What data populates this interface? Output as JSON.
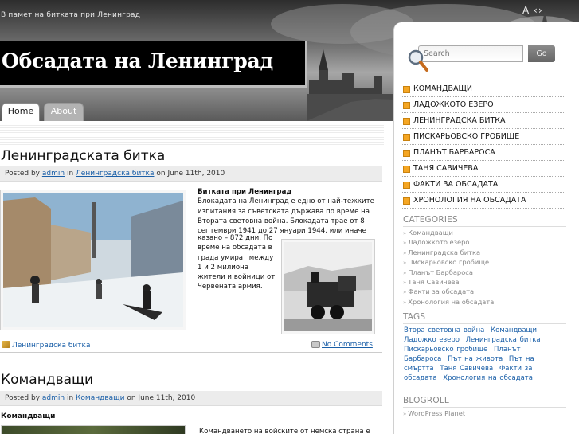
{
  "header": {
    "tagline": "В памет на битката при Ленинград",
    "site_title": "Обсадата на Ленинград",
    "font_tools": "A ‹›"
  },
  "nav": {
    "tabs": [
      {
        "label": "Home",
        "active": true
      },
      {
        "label": "About",
        "active": false
      }
    ]
  },
  "posts": [
    {
      "title": "Ленинградската битка",
      "meta": {
        "prefix": "Posted by",
        "author": "admin",
        "in": "in",
        "category": "Ленинградска битка",
        "date": "on June 11th, 2010"
      },
      "body_title": "Битката при Ленинград",
      "body_main": "Блокадата на Ленинград е едно от най-тежките изпитания за съветската държава по време на Втората световна война. Блокадата трае от 8 септември 1941 до 27 януари 1944, или иначе",
      "body_wrap": "казано – 872 дни. По време на обсадата в града умират между 1 и 2 милиона жители и войници от Червената армия.",
      "footer_category": "Ленинградска битка",
      "footer_comments": "No Comments"
    },
    {
      "title": "Командващи",
      "meta": {
        "prefix": "Posted by",
        "author": "admin",
        "in": "in",
        "category": "Командващи",
        "date": "on June 11th, 2010"
      },
      "body_title": "Командващи",
      "body_main": "Командването на войските от немска страна е"
    }
  ],
  "sidebar": {
    "search": {
      "placeholder": "Search",
      "button": "Go"
    },
    "menu": [
      "КОМАНДВАЩИ",
      "ЛАДОЖКОТО ЕЗЕРО",
      "ЛЕНИНГРАДСКА БИТКА",
      "ПИСКАРЬОВСКО ГРОБИЩЕ",
      "ПЛАНЪТ БАРБАРОСА",
      "ТАНЯ САВИЧЕВА",
      "ФАКТИ ЗА ОБСАДАТА",
      "ХРОНОЛОГИЯ НА ОБСАДАТА"
    ],
    "categories_heading": "CATEGORIES",
    "categories": [
      "Командващи",
      "Ладожкото езеро",
      "Ленинградска битка",
      "Пискарьовско гробище",
      "Планът Барбароса",
      "Таня Савичева",
      "Факти за обсадата",
      "Хронология на обсадата"
    ],
    "tags_heading": "TAGS",
    "tags": [
      "Втора световна война",
      "Командващи",
      "Ладожко езеро",
      "Ленинградска битка",
      "Пискарьовско гробище",
      "Планът Барбароса",
      "Път на живота",
      "Път на смъртта",
      "Таня Савичева",
      "Факти за обсадата",
      "Хронология на обсадата"
    ],
    "blogroll_heading": "BLOGROLL",
    "blogroll": [
      "WordPress Planet"
    ]
  },
  "colors": {
    "menu_bullet": "#f5a623",
    "link": "#1a5fa8",
    "title_box": "#000000"
  }
}
